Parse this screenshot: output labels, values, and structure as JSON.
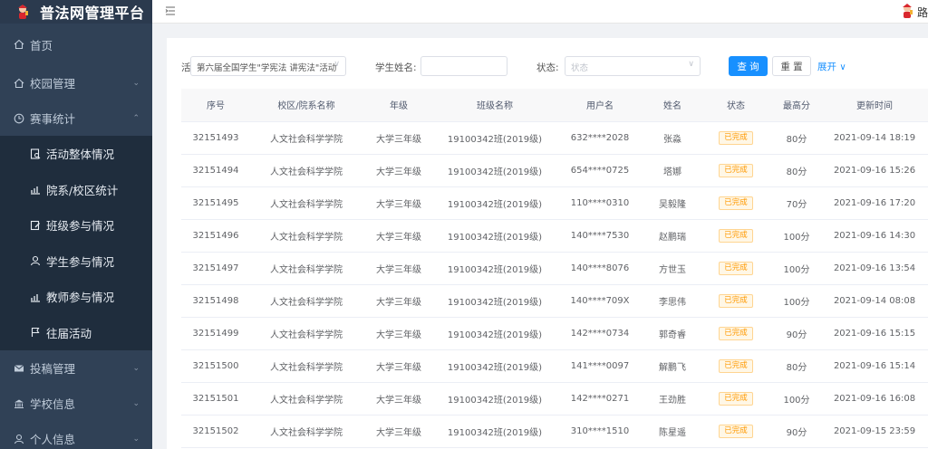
{
  "app": {
    "title": "普法网管理平台",
    "user_name": "路"
  },
  "sidebar": {
    "items": [
      {
        "label": "首页",
        "icon": "home-icon"
      },
      {
        "label": "校园管理",
        "icon": "home-icon"
      },
      {
        "label": "赛事统计",
        "icon": "clock-icon"
      }
    ],
    "sub_items": [
      {
        "label": "活动整体情况",
        "icon": "doc-search-icon"
      },
      {
        "label": "院系/校区统计",
        "icon": "bar-chart-icon"
      },
      {
        "label": "班级参与情况",
        "icon": "doc-edit-icon"
      },
      {
        "label": "学生参与情况",
        "icon": "user-icon"
      },
      {
        "label": "教师参与情况",
        "icon": "bar-chart-icon"
      },
      {
        "label": "往届活动",
        "icon": "flag-icon"
      }
    ],
    "bottom_items": [
      {
        "label": "投稿管理",
        "icon": "mail-icon"
      },
      {
        "label": "学校信息",
        "icon": "bank-icon"
      },
      {
        "label": "个人信息",
        "icon": "user-icon"
      }
    ]
  },
  "filters": {
    "activity_label": "活",
    "activity_value": "第六届全国学生\"学宪法 讲宪法\"活动",
    "student_name_label": "学生姓名:",
    "student_name_value": "",
    "status_label": "状态:",
    "status_placeholder": "状态",
    "query_button": "查 询",
    "reset_button": "重 置",
    "expand_link": "展开"
  },
  "table": {
    "columns": [
      "序号",
      "校区/院系名称",
      "年级",
      "班级名称",
      "用户名",
      "姓名",
      "状态",
      "最高分",
      "更新时间"
    ],
    "rows": [
      [
        "32151493",
        "人文社会科学学院",
        "大学三年级",
        "19100342班(2019级)",
        "632****2028",
        "张淼",
        "已完成",
        "80分",
        "2021-09-14 18:19"
      ],
      [
        "32151494",
        "人文社会科学学院",
        "大学三年级",
        "19100342班(2019级)",
        "654****0725",
        "塔娜",
        "已完成",
        "80分",
        "2021-09-16 15:26"
      ],
      [
        "32151495",
        "人文社会科学学院",
        "大学三年级",
        "19100342班(2019级)",
        "110****0310",
        "吴毅隆",
        "已完成",
        "70分",
        "2021-09-16 17:20"
      ],
      [
        "32151496",
        "人文社会科学学院",
        "大学三年级",
        "19100342班(2019级)",
        "140****7530",
        "赵鹏瑞",
        "已完成",
        "100分",
        "2021-09-16 14:30"
      ],
      [
        "32151497",
        "人文社会科学学院",
        "大学三年级",
        "19100342班(2019级)",
        "140****8076",
        "方世玉",
        "已完成",
        "100分",
        "2021-09-16 13:54"
      ],
      [
        "32151498",
        "人文社会科学学院",
        "大学三年级",
        "19100342班(2019级)",
        "140****709X",
        "李思伟",
        "已完成",
        "100分",
        "2021-09-14 08:08"
      ],
      [
        "32151499",
        "人文社会科学学院",
        "大学三年级",
        "19100342班(2019级)",
        "142****0734",
        "郭奇睿",
        "已完成",
        "90分",
        "2021-09-16 15:15"
      ],
      [
        "32151500",
        "人文社会科学学院",
        "大学三年级",
        "19100342班(2019级)",
        "141****0097",
        "解鹏飞",
        "已完成",
        "80分",
        "2021-09-16 15:14"
      ],
      [
        "32151501",
        "人文社会科学学院",
        "大学三年级",
        "19100342班(2019级)",
        "142****0271",
        "王劲胜",
        "已完成",
        "100分",
        "2021-09-16 16:08"
      ],
      [
        "32151502",
        "人文社会科学学院",
        "大学三年级",
        "19100342班(2019级)",
        "310****1510",
        "陈星遥",
        "已完成",
        "90分",
        "2021-09-15 23:59"
      ]
    ]
  },
  "colors": {
    "sidebar_bg": "#304156",
    "submenu_bg": "#1f2d3d",
    "primary": "#1890ff",
    "tag_orange": "#ff9900"
  }
}
